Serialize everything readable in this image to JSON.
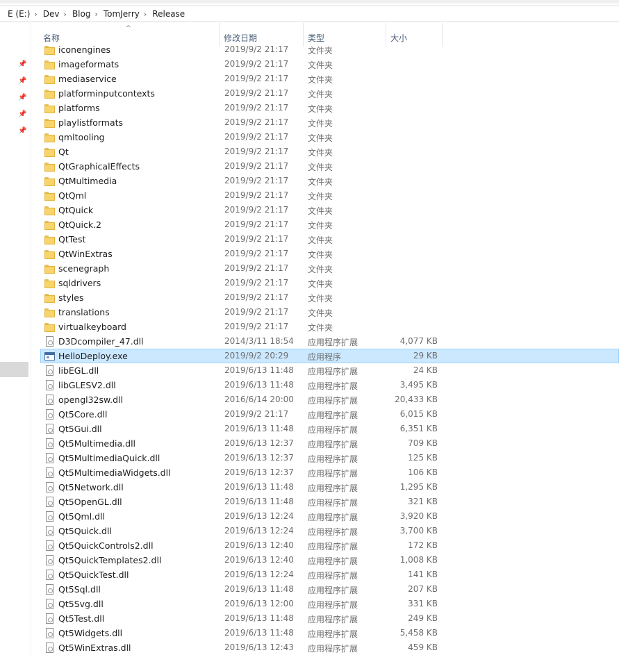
{
  "breadcrumb": [
    {
      "label": "E (E:)"
    },
    {
      "label": "Dev"
    },
    {
      "label": "Blog"
    },
    {
      "label": "TomJerry"
    },
    {
      "label": "Release"
    }
  ],
  "columns": {
    "name": "名称",
    "date": "修改日期",
    "type": "类型",
    "size": "大小"
  },
  "sort_arrow": "^",
  "nav_pin_icon": "📌",
  "files": [
    {
      "name": "iconengines",
      "date": "2019/9/2 21:17",
      "type": "文件夹",
      "size": "",
      "kind": "folder"
    },
    {
      "name": "imageformats",
      "date": "2019/9/2 21:17",
      "type": "文件夹",
      "size": "",
      "kind": "folder"
    },
    {
      "name": "mediaservice",
      "date": "2019/9/2 21:17",
      "type": "文件夹",
      "size": "",
      "kind": "folder"
    },
    {
      "name": "platforminputcontexts",
      "date": "2019/9/2 21:17",
      "type": "文件夹",
      "size": "",
      "kind": "folder"
    },
    {
      "name": "platforms",
      "date": "2019/9/2 21:17",
      "type": "文件夹",
      "size": "",
      "kind": "folder"
    },
    {
      "name": "playlistformats",
      "date": "2019/9/2 21:17",
      "type": "文件夹",
      "size": "",
      "kind": "folder"
    },
    {
      "name": "qmltooling",
      "date": "2019/9/2 21:17",
      "type": "文件夹",
      "size": "",
      "kind": "folder"
    },
    {
      "name": "Qt",
      "date": "2019/9/2 21:17",
      "type": "文件夹",
      "size": "",
      "kind": "folder"
    },
    {
      "name": "QtGraphicalEffects",
      "date": "2019/9/2 21:17",
      "type": "文件夹",
      "size": "",
      "kind": "folder"
    },
    {
      "name": "QtMultimedia",
      "date": "2019/9/2 21:17",
      "type": "文件夹",
      "size": "",
      "kind": "folder"
    },
    {
      "name": "QtQml",
      "date": "2019/9/2 21:17",
      "type": "文件夹",
      "size": "",
      "kind": "folder"
    },
    {
      "name": "QtQuick",
      "date": "2019/9/2 21:17",
      "type": "文件夹",
      "size": "",
      "kind": "folder"
    },
    {
      "name": "QtQuick.2",
      "date": "2019/9/2 21:17",
      "type": "文件夹",
      "size": "",
      "kind": "folder"
    },
    {
      "name": "QtTest",
      "date": "2019/9/2 21:17",
      "type": "文件夹",
      "size": "",
      "kind": "folder"
    },
    {
      "name": "QtWinExtras",
      "date": "2019/9/2 21:17",
      "type": "文件夹",
      "size": "",
      "kind": "folder"
    },
    {
      "name": "scenegraph",
      "date": "2019/9/2 21:17",
      "type": "文件夹",
      "size": "",
      "kind": "folder"
    },
    {
      "name": "sqldrivers",
      "date": "2019/9/2 21:17",
      "type": "文件夹",
      "size": "",
      "kind": "folder"
    },
    {
      "name": "styles",
      "date": "2019/9/2 21:17",
      "type": "文件夹",
      "size": "",
      "kind": "folder"
    },
    {
      "name": "translations",
      "date": "2019/9/2 21:17",
      "type": "文件夹",
      "size": "",
      "kind": "folder"
    },
    {
      "name": "virtualkeyboard",
      "date": "2019/9/2 21:17",
      "type": "文件夹",
      "size": "",
      "kind": "folder"
    },
    {
      "name": "D3Dcompiler_47.dll",
      "date": "2014/3/11 18:54",
      "type": "应用程序扩展",
      "size": "4,077 KB",
      "kind": "dll"
    },
    {
      "name": "HelloDeploy.exe",
      "date": "2019/9/2 20:29",
      "type": "应用程序",
      "size": "29 KB",
      "kind": "exe",
      "selected": true
    },
    {
      "name": "libEGL.dll",
      "date": "2019/6/13 11:48",
      "type": "应用程序扩展",
      "size": "24 KB",
      "kind": "dll"
    },
    {
      "name": "libGLESV2.dll",
      "date": "2019/6/13 11:48",
      "type": "应用程序扩展",
      "size": "3,495 KB",
      "kind": "dll"
    },
    {
      "name": "opengl32sw.dll",
      "date": "2016/6/14 20:00",
      "type": "应用程序扩展",
      "size": "20,433 KB",
      "kind": "dll"
    },
    {
      "name": "Qt5Core.dll",
      "date": "2019/9/2 21:17",
      "type": "应用程序扩展",
      "size": "6,015 KB",
      "kind": "dll"
    },
    {
      "name": "Qt5Gui.dll",
      "date": "2019/6/13 11:48",
      "type": "应用程序扩展",
      "size": "6,351 KB",
      "kind": "dll"
    },
    {
      "name": "Qt5Multimedia.dll",
      "date": "2019/6/13 12:37",
      "type": "应用程序扩展",
      "size": "709 KB",
      "kind": "dll"
    },
    {
      "name": "Qt5MultimediaQuick.dll",
      "date": "2019/6/13 12:37",
      "type": "应用程序扩展",
      "size": "125 KB",
      "kind": "dll"
    },
    {
      "name": "Qt5MultimediaWidgets.dll",
      "date": "2019/6/13 12:37",
      "type": "应用程序扩展",
      "size": "106 KB",
      "kind": "dll"
    },
    {
      "name": "Qt5Network.dll",
      "date": "2019/6/13 11:48",
      "type": "应用程序扩展",
      "size": "1,295 KB",
      "kind": "dll"
    },
    {
      "name": "Qt5OpenGL.dll",
      "date": "2019/6/13 11:48",
      "type": "应用程序扩展",
      "size": "321 KB",
      "kind": "dll"
    },
    {
      "name": "Qt5Qml.dll",
      "date": "2019/6/13 12:24",
      "type": "应用程序扩展",
      "size": "3,920 KB",
      "kind": "dll"
    },
    {
      "name": "Qt5Quick.dll",
      "date": "2019/6/13 12:24",
      "type": "应用程序扩展",
      "size": "3,700 KB",
      "kind": "dll"
    },
    {
      "name": "Qt5QuickControls2.dll",
      "date": "2019/6/13 12:40",
      "type": "应用程序扩展",
      "size": "172 KB",
      "kind": "dll"
    },
    {
      "name": "Qt5QuickTemplates2.dll",
      "date": "2019/6/13 12:40",
      "type": "应用程序扩展",
      "size": "1,008 KB",
      "kind": "dll"
    },
    {
      "name": "Qt5QuickTest.dll",
      "date": "2019/6/13 12:24",
      "type": "应用程序扩展",
      "size": "141 KB",
      "kind": "dll"
    },
    {
      "name": "Qt5Sql.dll",
      "date": "2019/6/13 11:48",
      "type": "应用程序扩展",
      "size": "207 KB",
      "kind": "dll"
    },
    {
      "name": "Qt5Svg.dll",
      "date": "2019/6/13 12:00",
      "type": "应用程序扩展",
      "size": "331 KB",
      "kind": "dll"
    },
    {
      "name": "Qt5Test.dll",
      "date": "2019/6/13 11:48",
      "type": "应用程序扩展",
      "size": "249 KB",
      "kind": "dll"
    },
    {
      "name": "Qt5Widgets.dll",
      "date": "2019/6/13 11:48",
      "type": "应用程序扩展",
      "size": "5,458 KB",
      "kind": "dll"
    },
    {
      "name": "Qt5WinExtras.dll",
      "date": "2019/6/13 12:43",
      "type": "应用程序扩展",
      "size": "459 KB",
      "kind": "dll"
    }
  ]
}
